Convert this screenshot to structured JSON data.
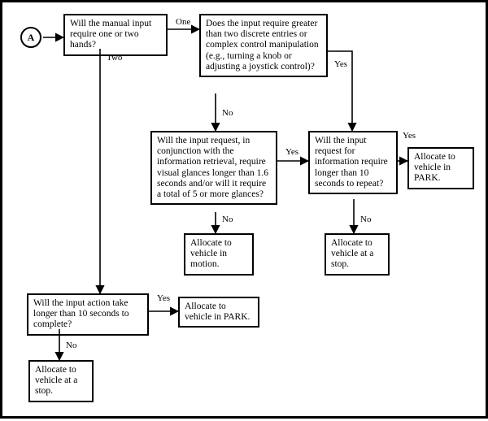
{
  "start": {
    "label": "A"
  },
  "nodes": {
    "q_hands": "Will the manual input require one or two hands?",
    "q_complex": "Does the input require greater than two discrete entries or complex control manipulation (e.g., turning a knob or adjusting a joystick control)?",
    "q_glances": "Will the input request, in conjunction with the information retrieval, require visual glances longer than 1.6 seconds and/or will it require a total of 5 or more glances?",
    "q_repeat": "Will the input request for information require longer than 10 seconds to repeat?",
    "q_complete": "Will the input action take longer than 10 seconds to complete?",
    "out_motion": "Allocate to vehicle in motion.",
    "out_stop_1": "Allocate to vehicle at a stop.",
    "out_park_1": "Allocate to vehicle in PARK.",
    "out_park_2": "Allocate to vehicle in PARK.",
    "out_stop_2": "Allocate to vehicle at a stop."
  },
  "edges": {
    "one": "One",
    "two": "Two",
    "yes": "Yes",
    "no": "No"
  }
}
